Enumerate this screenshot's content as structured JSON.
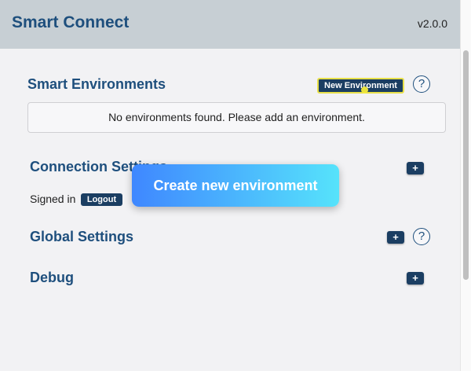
{
  "header": {
    "title": "Smart Connect",
    "version": "v2.0.0"
  },
  "smart_environments": {
    "title": "Smart Environments",
    "new_button_label": "New Environment",
    "help_glyph": "?",
    "empty_message": "No environments found. Please add an environment."
  },
  "connection_settings": {
    "title": "Connection Settings",
    "expand_glyph": "+",
    "signed_in_label": "Signed in",
    "logout_label": "Logout"
  },
  "global_settings": {
    "title": "Global Settings",
    "expand_glyph": "+",
    "help_glyph": "?"
  },
  "debug": {
    "title": "Debug",
    "expand_glyph": "+"
  },
  "tooltip": {
    "text": "Create new environment"
  },
  "colors": {
    "header_bg": "#c7cfd4",
    "title_blue": "#1e4f7d",
    "button_navy": "#1b3e62",
    "highlight_yellow": "#e8e04a",
    "tooltip_gradient_start": "#3f87ff",
    "tooltip_gradient_end": "#56e3fb"
  },
  "icons": {
    "help": "question-circle-icon",
    "expand": "plus-icon"
  }
}
